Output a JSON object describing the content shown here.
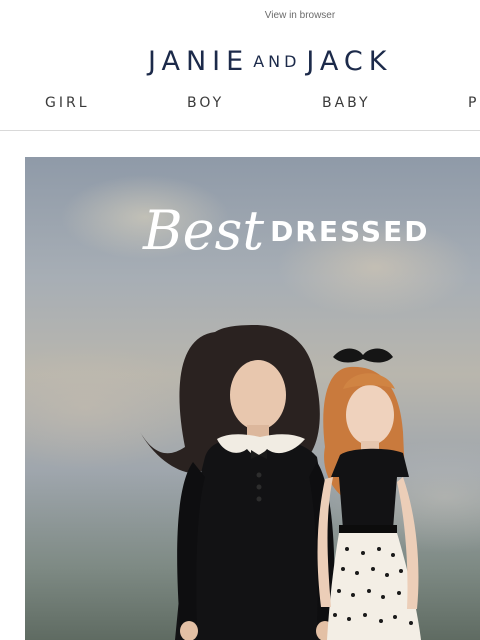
{
  "header": {
    "view_in_browser": "View in browser",
    "logo": {
      "part1": "JANIE",
      "part2": "AND",
      "part3": "JACK"
    }
  },
  "nav": {
    "items": [
      "GIRL",
      "BOY",
      "BABY",
      "P"
    ]
  },
  "hero": {
    "script_word": "Best",
    "caps_word": "DRESSED"
  },
  "colors": {
    "brand_navy": "#1c2a4a",
    "nav_text": "#3a3a3a",
    "divider": "#d9d9d9"
  }
}
